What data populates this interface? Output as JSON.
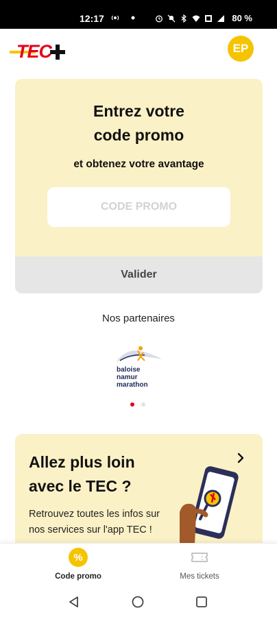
{
  "status_bar": {
    "time": "12:17",
    "battery": "80 %"
  },
  "header": {
    "logo_text": "TEC+",
    "avatar_initials": "EP"
  },
  "promo": {
    "title_line1": "Entrez votre",
    "title_line2": "code promo",
    "subtitle": "et obtenez votre avantage",
    "input_placeholder": "CODE PROMO",
    "input_value": "",
    "validate_label": "Valider"
  },
  "partners": {
    "title": "Nos partenaires",
    "items": [
      {
        "logo_line1": "baloise",
        "logo_line2": "namur",
        "logo_line3": "marathon"
      }
    ],
    "carousel_count": 2,
    "active_index": 0
  },
  "more": {
    "title_line1": "Allez plus loin",
    "title_line2": "avec le TEC ?",
    "text": "Retrouvez toutes les infos sur nos services sur l'app TEC !"
  },
  "bottom_nav": {
    "items": [
      {
        "label": "Code promo",
        "icon": "percent-icon",
        "active": true
      },
      {
        "label": "Mes tickets",
        "icon": "ticket-icon",
        "active": false
      }
    ]
  },
  "colors": {
    "brand_yellow": "#f5c400",
    "brand_red": "#e3001b",
    "card_background": "#fbf1c7",
    "button_grey": "#e6e6e6"
  }
}
